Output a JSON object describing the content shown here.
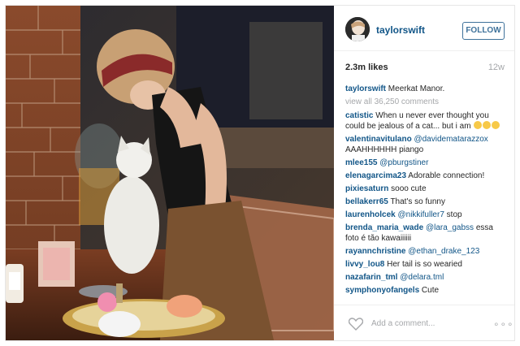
{
  "post": {
    "username": "taylorswift",
    "follow_label": "FOLLOW",
    "likes": "2.3m likes",
    "age": "12w"
  },
  "caption": {
    "username": "taylorswift",
    "text": "Meerkat Manor."
  },
  "view_all": "view all 36,250 comments",
  "comments": [
    {
      "user": "catistic",
      "mention": "",
      "text": "When u never ever thought you could be jealous of a cat... but i am",
      "emojis": 3
    },
    {
      "user": "valentinavitulano",
      "mention": "@davidematarazzox",
      "text": "AAAHHHHHH piango"
    },
    {
      "user": "mlee155",
      "mention": "@pburgstiner",
      "text": ""
    },
    {
      "user": "elenagarcima23",
      "mention": "",
      "text": "Adorable connection!"
    },
    {
      "user": "pixiesaturn",
      "mention": "",
      "text": "sooo cute"
    },
    {
      "user": "bellakerr65",
      "mention": "",
      "text": "That's so funny"
    },
    {
      "user": "laurenholcek",
      "mention": "@nikkifuller7",
      "text": "stop"
    },
    {
      "user": "brenda_maria_wade",
      "mention": "@lara_gabss",
      "text": "essa foto é tão kawaiiiiii"
    },
    {
      "user": "rayannchristine",
      "mention": "@ethan_drake_123",
      "text": ""
    },
    {
      "user": "livvy_lou8",
      "mention": "",
      "text": "Her tail is so wearied"
    },
    {
      "user": "nazafarin_tml",
      "mention": "@delara.tml",
      "text": ""
    },
    {
      "user": "symphonyofangels",
      "mention": "",
      "text": "Cute"
    }
  ],
  "footer": {
    "add_comment": "Add a comment...",
    "more": "∘∘∘"
  },
  "colors": {
    "link": "#125688",
    "follow": "#3f729b",
    "muted": "#a5a7aa"
  },
  "icons": [
    "heart-icon",
    "more-options-icon"
  ]
}
